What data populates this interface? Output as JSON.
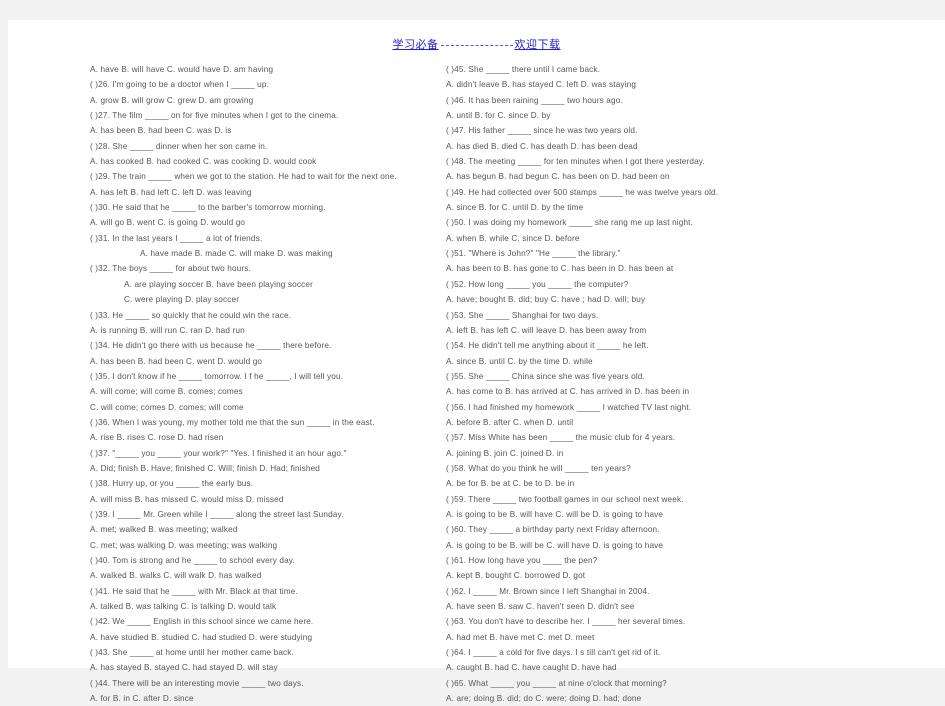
{
  "header": {
    "left_text": "学习必备",
    "right_text": "欢迎下载",
    "color": "#2222cc"
  },
  "document": {
    "type": "english-grammar-worksheet",
    "columns": 2,
    "question_range": "26-65",
    "text_color": "#55565a",
    "page_background": "#ffffff",
    "outer_background": "#f2f2f2"
  },
  "left_column": {
    "lines": [
      {
        "id": "l1",
        "kind": "options",
        "indent": 0,
        "text": "A. have                     B. will have              C. would have            D. am having"
      },
      {
        "id": "l2",
        "kind": "question",
        "indent": 0,
        "text": "(        )26. I'm going to be a doctor when I _____ up."
      },
      {
        "id": "l3",
        "kind": "options",
        "indent": 0,
        "text": "A. grow                     B. will grow              C. grew                      D. am growing"
      },
      {
        "id": "l4",
        "kind": "question",
        "indent": 0,
        "text": "(        )27. The film _____ on for five minutes when I got to the cinema."
      },
      {
        "id": "l5",
        "kind": "options",
        "indent": 0,
        "text": "A. has been          B. had been              C. was                      D. is"
      },
      {
        "id": "l6",
        "kind": "question",
        "indent": 0,
        "text": "(        )28. She _____ dinner when her son came in."
      },
      {
        "id": "l7",
        "kind": "options",
        "indent": 0,
        "text": "A. has cooked               B. had cooked          C. was cooking        D. would cook"
      },
      {
        "id": "l8",
        "kind": "question",
        "indent": 0,
        "text": "(        )29. The train _____ when we got to the station. He had to wait for the next one."
      },
      {
        "id": "l9",
        "kind": "options",
        "indent": 0,
        "text": "A. has left                 B. had left              C. left                       D. was leaving"
      },
      {
        "id": "l10",
        "kind": "question",
        "indent": 0,
        "text": "(        )30. He said that he _____ to the barber's tomorrow morning."
      },
      {
        "id": "l11",
        "kind": "options",
        "indent": 0,
        "text": "A. will go                  B. went                    C. is going                 D. would go"
      },
      {
        "id": "l12",
        "kind": "question",
        "indent": 0,
        "text": "(        )31. In the last years I _____ a lot of friends."
      },
      {
        "id": "l13",
        "kind": "options",
        "indent": 2,
        "text": "A. have made         B. made            C. will make        D. was making"
      },
      {
        "id": "l14",
        "kind": "question",
        "indent": 0,
        "text": "(        )32. The boys _____ for about two hours."
      },
      {
        "id": "l15",
        "kind": "options",
        "indent": 1,
        "text": "A. are playing soccer                            B. have been playing soccer"
      },
      {
        "id": "l16",
        "kind": "options",
        "indent": 1,
        "text": "C. were playing                                    D. play soccer"
      },
      {
        "id": "l17",
        "kind": "question",
        "indent": 0,
        "text": "(        )33. He _____ so quickly that he could win the race."
      },
      {
        "id": "l18",
        "kind": "options",
        "indent": 0,
        "text": "A. is running              B. will run               C. ran                         D. had run"
      },
      {
        "id": "l19",
        "kind": "question",
        "indent": 0,
        "text": "(        )34. He didn't go there with us because he _____ there before."
      },
      {
        "id": "l20",
        "kind": "options",
        "indent": 0,
        "text": "A. has been           B. had been             C. went                    D. would go"
      },
      {
        "id": "l21",
        "kind": "question",
        "indent": 0,
        "text": "(        )35. I don't know if he _____ tomorrow. I f he _____, I will tell you."
      },
      {
        "id": "l22",
        "kind": "options",
        "indent": 0,
        "text": "A. will come; will come                         B. comes; comes"
      },
      {
        "id": "l23",
        "kind": "options",
        "indent": 0,
        "text": "C. will come; comes                              D. comes; will come"
      },
      {
        "id": "l24",
        "kind": "question",
        "indent": 0,
        "text": "(        )36. When I was young, my mother told me that the sun _____ in the east."
      },
      {
        "id": "l25",
        "kind": "options",
        "indent": 0,
        "text": "A. rise                       B. rises                     C. rose                      D. had risen"
      },
      {
        "id": "l26",
        "kind": "question",
        "indent": 0,
        "text": "(        )37. \"_____ you _____ your work?\"    \"Yes. I finished it an hour ago.\""
      },
      {
        "id": "l27",
        "kind": "options",
        "indent": 0,
        "text": "A. Did; finish           B. Have; finished    C. Will; finish          D. Had; finished"
      },
      {
        "id": "l28",
        "kind": "question",
        "indent": 0,
        "text": "(        )38. Hurry up, or you _____ the early bus."
      },
      {
        "id": "l29",
        "kind": "options",
        "indent": 0,
        "text": "A. will miss              B. has missed         C. would miss        D. missed"
      },
      {
        "id": "l30",
        "kind": "question",
        "indent": 0,
        "text": "(        )39. I _____ Mr. Green while I _____ along the street last Sunday."
      },
      {
        "id": "l31",
        "kind": "options",
        "indent": 0,
        "text": "A. met; walked                                       B. was meeting; walked"
      },
      {
        "id": "l32",
        "kind": "options",
        "indent": 0,
        "text": "C. met; was walking                              D. was meeting; was walking"
      },
      {
        "id": "l33",
        "kind": "question",
        "indent": 0,
        "text": "(        )40. Tom is strong and he _____ to school every day."
      },
      {
        "id": "l34",
        "kind": "options",
        "indent": 0,
        "text": "A. walked          B. walks                   C. will walk              D. has walked"
      },
      {
        "id": "l35",
        "kind": "question",
        "indent": 0,
        "text": "(        )41. He said that he _____ with Mr. Black at that time."
      },
      {
        "id": "l36",
        "kind": "options",
        "indent": 0,
        "text": "A. talked                  B. was talking  C. is talking              D. would talk"
      },
      {
        "id": "l37",
        "kind": "question",
        "indent": 0,
        "text": "(        )42. We _____ English in this school since we came here."
      },
      {
        "id": "l38",
        "kind": "options",
        "indent": 0,
        "text": "A. have studied      B. studied               C. had studied D. were studying"
      },
      {
        "id": "l39",
        "kind": "question",
        "indent": 0,
        "text": "(        )43. She _____ at home until her mother came back."
      },
      {
        "id": "l40",
        "kind": "options",
        "indent": 0,
        "text": "A. has stayed         B. stayed                C. had stayed         D. will stay"
      },
      {
        "id": "l41",
        "kind": "question",
        "indent": 0,
        "text": "(        )44. There will be an interesting movie _____ two days."
      },
      {
        "id": "l42",
        "kind": "options",
        "indent": 0,
        "text": "A. for                       B. in                   C. after                     D. since"
      }
    ]
  },
  "right_column": {
    "lines": [
      {
        "id": "r1",
        "kind": "question",
        "indent": 0,
        "text": "(        )45. She _____ there until I came back."
      },
      {
        "id": "r2",
        "kind": "options",
        "indent": 0,
        "text": "A. didn't leave B. has stayed             C. left                         D. was staying"
      },
      {
        "id": "r3",
        "kind": "question",
        "indent": 0,
        "text": "(        )46. It has been raining _____ two hours ago."
      },
      {
        "id": "r4",
        "kind": "options",
        "indent": 0,
        "text": "A. until                    B. for                         C. since                     D. by"
      },
      {
        "id": "r5",
        "kind": "question",
        "indent": 0,
        "text": "(        )47. His father _____ since he was two years old."
      },
      {
        "id": "r6",
        "kind": "options",
        "indent": 0,
        "text": "A. has died              B. died                       C. has death            D. has been dead"
      },
      {
        "id": "r7",
        "kind": "question",
        "indent": 0,
        "text": "(        )48. The meeting _____ for ten minutes when I got there yesterday."
      },
      {
        "id": "r8",
        "kind": "options",
        "indent": 0,
        "text": "A. has begun           B. had begun            C. has been on D. had been on"
      },
      {
        "id": "r9",
        "kind": "question",
        "indent": 0,
        "text": "(        )49. He had collected over 500 stamps _____ he was twelve years old."
      },
      {
        "id": "r10",
        "kind": "options",
        "indent": 0,
        "text": "A. since                    B. for                         C. until                      D. by the time"
      },
      {
        "id": "r11",
        "kind": "question",
        "indent": 0,
        "text": "(        )50. I was doing my homework _____ she rang me up last night."
      },
      {
        "id": "r12",
        "kind": "options",
        "indent": 0,
        "text": "A. when                   B. while                     C. since                     D. before"
      },
      {
        "id": "r13",
        "kind": "question",
        "indent": 0,
        "text": "(        )51. \"Where is John?\"        \"He _____ the library.\""
      },
      {
        "id": "r14",
        "kind": "options",
        "indent": 0,
        "text": "A. has been to B. has gone to            C. has been in D. has been at"
      },
      {
        "id": "r15",
        "kind": "question",
        "indent": 0,
        "text": "(        )52. How long _____ you _____ the computer?"
      },
      {
        "id": "r16",
        "kind": "options",
        "indent": 0,
        "text": "A. have; bought      B. did; buy                 C. have ; had            D. will; buy"
      },
      {
        "id": "r17",
        "kind": "question",
        "indent": 0,
        "text": "(        )53. She _____ Shanghai for two days."
      },
      {
        "id": "r18",
        "kind": "options",
        "indent": 0,
        "text": "A. left                       B. has left            C. will leave             D. has been away from"
      },
      {
        "id": "r19",
        "kind": "question",
        "indent": 0,
        "text": "(        )54. He didn't tell me anything about it _____ he left."
      },
      {
        "id": "r20",
        "kind": "options",
        "indent": 0,
        "text": "A. since                    B. until                      C. by the time          D. while"
      },
      {
        "id": "r21",
        "kind": "question",
        "indent": 0,
        "text": "(        )55. She _____ China since she was five years old."
      },
      {
        "id": "r22",
        "kind": "options",
        "indent": 0,
        "text": "A. has come to B. has arrived at      C. has arrived in     D. has been in"
      },
      {
        "id": "r23",
        "kind": "question",
        "indent": 0,
        "text": "(        )56. I had finished my homework _____ I watched TV last night."
      },
      {
        "id": "r24",
        "kind": "options",
        "indent": 0,
        "text": "A. before                  B. after                      C. when                    D. until"
      },
      {
        "id": "r25",
        "kind": "question",
        "indent": 0,
        "text": "(        )57. Miss White has been _____ the music club for 4 years."
      },
      {
        "id": "r26",
        "kind": "options",
        "indent": 0,
        "text": "A. joining            B. join                       C. joined                   D. in"
      },
      {
        "id": "r27",
        "kind": "question",
        "indent": 0,
        "text": "(        )58. What do you think he will _____ ten years?"
      },
      {
        "id": "r28",
        "kind": "options",
        "indent": 0,
        "text": "A. be for                   B. be at                      C. be to                     D. be in"
      },
      {
        "id": "r29",
        "kind": "question",
        "indent": 0,
        "text": "(        )59. There _____ two football games in our school next week."
      },
      {
        "id": "r30",
        "kind": "options",
        "indent": 0,
        "text": "A. is going to be     B. will have               C. will be            D. is going to have"
      },
      {
        "id": "r31",
        "kind": "question",
        "indent": 0,
        "text": "(        )60. They _____ a birthday party next Friday afternoon."
      },
      {
        "id": "r32",
        "kind": "options",
        "indent": 0,
        "text": "A. is going to be     B. will be                   C. will have              D. is going to have"
      },
      {
        "id": "r33",
        "kind": "question",
        "indent": 0,
        "text": "(        )61. How long have you ____ the pen?"
      },
      {
        "id": "r34",
        "kind": "options",
        "indent": 0,
        "text": "A. kept                     B. bought             C. borrowed            D. got"
      },
      {
        "id": "r35",
        "kind": "question",
        "indent": 0,
        "text": "(        )62. I _____ Mr. Brown since I left Shanghai in 2004."
      },
      {
        "id": "r36",
        "kind": "options",
        "indent": 0,
        "text": "A. have seen            B. saw                        C. haven't seen        D. didn't see"
      },
      {
        "id": "r37",
        "kind": "question",
        "indent": 0,
        "text": "(        )63. You don't have to describe her. I _____ her several times."
      },
      {
        "id": "r38",
        "kind": "options",
        "indent": 0,
        "text": "A. had met               B. have met              C. met                        D. meet"
      },
      {
        "id": "r39",
        "kind": "question",
        "indent": 0,
        "text": "(        )64. I _____ a cold for five days. I s till can't get rid of it."
      },
      {
        "id": "r40",
        "kind": "options",
        "indent": 0,
        "text": "A. caught             B. had                         C. have caught D. have had"
      },
      {
        "id": "r41",
        "kind": "question",
        "indent": 0,
        "text": "(        )65. What _____ you _____ at nine o'clock that morning?"
      },
      {
        "id": "r42",
        "kind": "options",
        "indent": 0,
        "text": "A. are; doing            B. did; do               C. were; doing D. had; done"
      }
    ]
  }
}
